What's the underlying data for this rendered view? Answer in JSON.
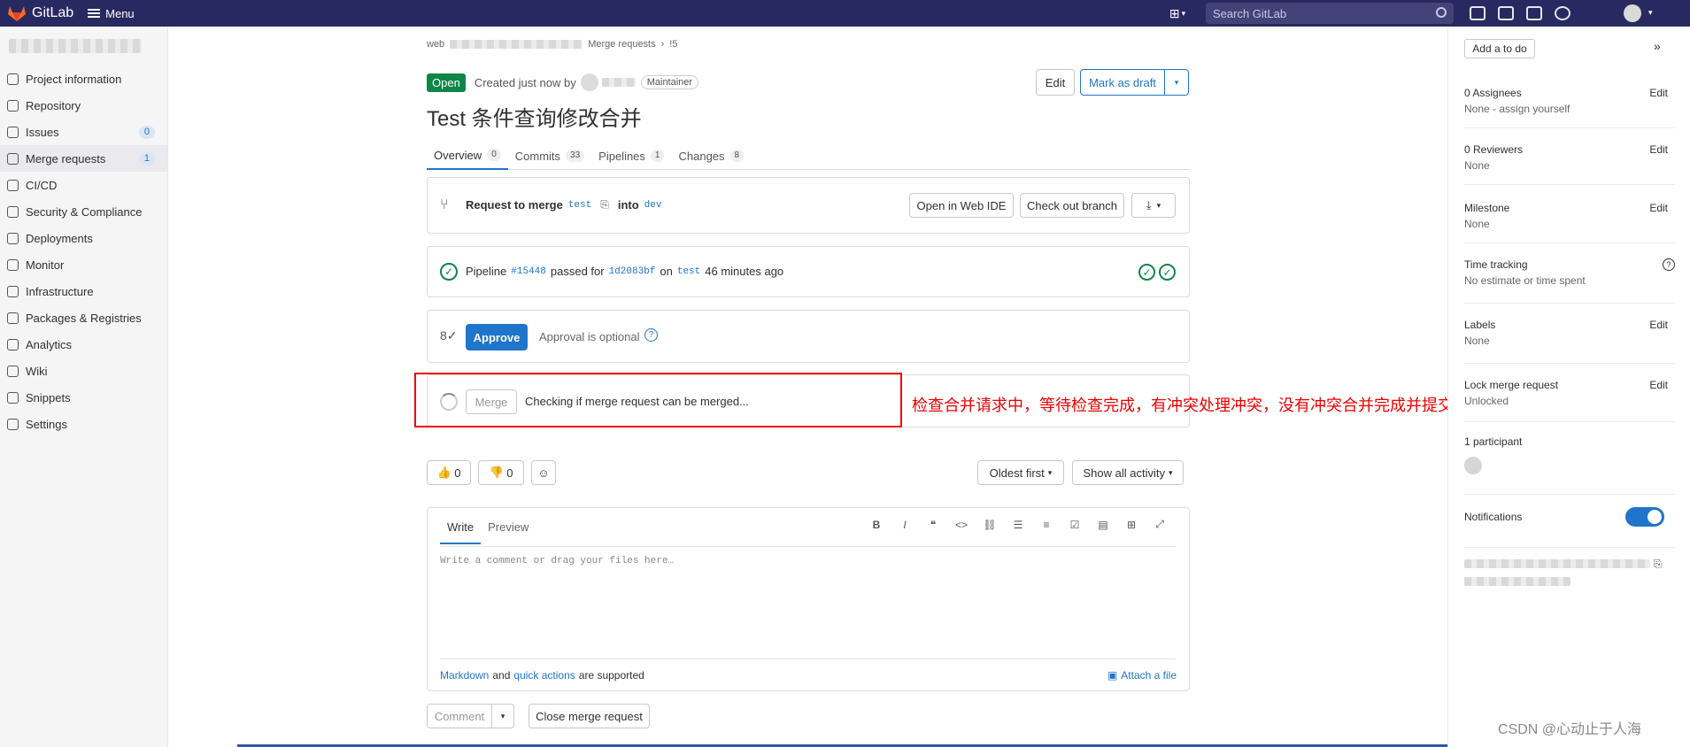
{
  "topbar": {
    "app_name": "GitLab",
    "menu_label": "Menu",
    "search_placeholder": "Search GitLab"
  },
  "nav": {
    "items": [
      {
        "label": "Project information",
        "icon": "project-icon",
        "badge": ""
      },
      {
        "label": "Repository",
        "icon": "repository-icon",
        "badge": ""
      },
      {
        "label": "Issues",
        "icon": "issues-icon",
        "badge": "0"
      },
      {
        "label": "Merge requests",
        "icon": "merge-request-icon",
        "badge": "1"
      },
      {
        "label": "CI/CD",
        "icon": "rocket-icon",
        "badge": ""
      },
      {
        "label": "Security & Compliance",
        "icon": "shield-icon",
        "badge": ""
      },
      {
        "label": "Deployments",
        "icon": "deployments-icon",
        "badge": ""
      },
      {
        "label": "Monitor",
        "icon": "monitor-icon",
        "badge": ""
      },
      {
        "label": "Infrastructure",
        "icon": "cloud-icon",
        "badge": ""
      },
      {
        "label": "Packages & Registries",
        "icon": "package-icon",
        "badge": ""
      },
      {
        "label": "Analytics",
        "icon": "chart-icon",
        "badge": ""
      },
      {
        "label": "Wiki",
        "icon": "book-icon",
        "badge": ""
      },
      {
        "label": "Snippets",
        "icon": "scissors-icon",
        "badge": ""
      },
      {
        "label": "Settings",
        "icon": "gear-icon",
        "badge": ""
      }
    ]
  },
  "breadcrumb": {
    "root": "web",
    "section": "Merge requests",
    "current": "!5"
  },
  "mr": {
    "status": "Open",
    "created": "Created just now by",
    "role": "Maintainer",
    "edit": "Edit",
    "mark_draft": "Mark as draft",
    "title": "Test 条件查询修改合并",
    "tabs": [
      {
        "label": "Overview",
        "count": "0"
      },
      {
        "label": "Commits",
        "count": "33"
      },
      {
        "label": "Pipelines",
        "count": "1"
      },
      {
        "label": "Changes",
        "count": "8"
      }
    ],
    "request": {
      "prefix": "Request to merge",
      "source": "test",
      "into": "into",
      "target": "dev",
      "open_ide": "Open in Web IDE",
      "checkout": "Check out branch"
    },
    "pipeline": {
      "prefix": "Pipeline",
      "id": "#15448",
      "passed_for": "passed for",
      "sha": "1d2083bf",
      "on": "on",
      "branch": "test",
      "ago": "46 minutes ago"
    },
    "approval": {
      "button": "Approve",
      "text": "Approval is optional"
    },
    "merge": {
      "button": "Merge",
      "text": "Checking if merge request can be merged..."
    },
    "annotation": "检查合并请求中，等待检查完成，有冲突处理冲突，没有冲突合并完成并提交",
    "reactions": {
      "up": "0",
      "down": "0"
    },
    "activity": {
      "sort": "Oldest first",
      "filter": "Show all activity"
    },
    "editor": {
      "write": "Write",
      "preview": "Preview",
      "placeholder": "Write a comment or drag your files here…",
      "markdown": "Markdown",
      "and": "and",
      "quick_actions": "quick actions",
      "supported": "are supported",
      "attach": "Attach a file"
    },
    "comment": "Comment",
    "close": "Close merge request"
  },
  "sidebar": {
    "add_todo": "Add a to do",
    "assignees": {
      "label": "0 Assignees",
      "value": "None - assign yourself",
      "edit": "Edit"
    },
    "reviewers": {
      "label": "0 Reviewers",
      "value": "None",
      "edit": "Edit"
    },
    "milestone": {
      "label": "Milestone",
      "value": "None",
      "edit": "Edit"
    },
    "time": {
      "label": "Time tracking",
      "value": "No estimate or time spent"
    },
    "labels": {
      "label": "Labels",
      "value": "None",
      "edit": "Edit"
    },
    "lock": {
      "label": "Lock merge request",
      "value": "Unlocked",
      "edit": "Edit"
    },
    "participants": "1 participant",
    "notifications": "Notifications"
  },
  "watermark": "CSDN @心动止于人海"
}
